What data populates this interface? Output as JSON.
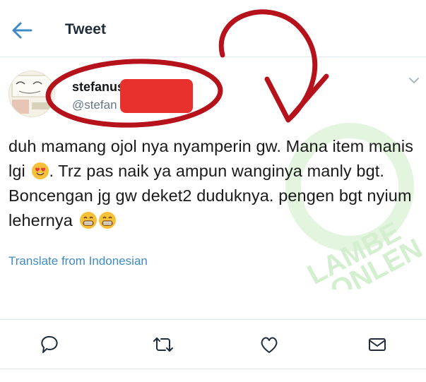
{
  "header": {
    "title": "Tweet",
    "back_icon": "arrow-left-icon"
  },
  "tweet": {
    "display_name": "stefanus",
    "handle": "@stefan",
    "text_parts": [
      "duh mamang ojol nya nyamperin gw. Mana item manis lgi ",
      ". Trz pas naik ya ampun wanginya manly bgt. Boncengan jg gw deket2 duduknya. pengen bgt nyium lehernya "
    ],
    "emojis": [
      "heart-eyes-emoji",
      "grinning-emoji",
      "grinning-emoji"
    ],
    "translate_link": "Translate from Indonesian"
  },
  "actions": [
    "reply-icon",
    "retweet-icon",
    "like-icon",
    "message-icon"
  ],
  "watermark": {
    "lines": [
      "LAMBE",
      "ONLEN"
    ],
    "color": "#c9ecc6"
  },
  "colors": {
    "link": "#3f8cc4",
    "annotation": "#b5121b",
    "redaction": "#e8302d",
    "icon": "#1f2d3a"
  }
}
